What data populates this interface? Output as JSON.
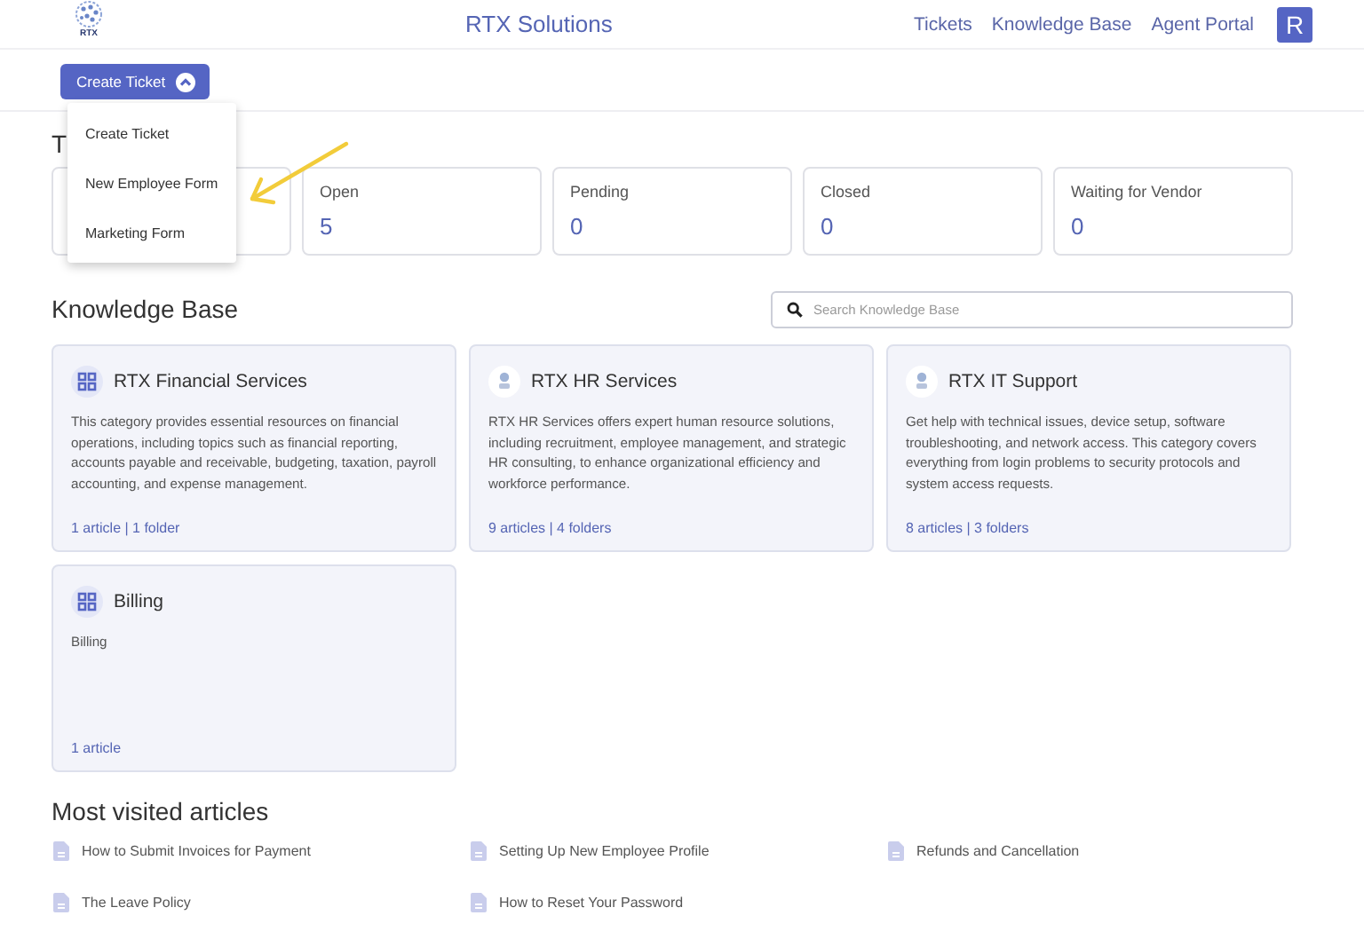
{
  "header": {
    "logo_text": "RTX",
    "title": "RTX Solutions",
    "nav": [
      "Tickets",
      "Knowledge Base",
      "Agent Portal"
    ],
    "avatar": "R"
  },
  "create_ticket": {
    "label": "Create Ticket",
    "expanded": true,
    "menu": [
      "Create Ticket",
      "New Employee Form",
      "Marketing Form"
    ]
  },
  "tickets": {
    "title": "T",
    "stats": [
      {
        "label": "Open",
        "value": "5"
      },
      {
        "label": "Pending",
        "value": "0"
      },
      {
        "label": "Closed",
        "value": "0"
      },
      {
        "label": "Waiting for Vendor",
        "value": "0"
      }
    ]
  },
  "knowledge_base": {
    "title": "Knowledge Base",
    "search": {
      "placeholder": "Search Knowledge Base"
    },
    "categories": [
      {
        "kind": "grid",
        "title": "RTX Financial Services",
        "description": "This category provides essential resources on financial operations, including topics such as financial reporting, accounts payable and receivable, budgeting, taxation, payroll accounting, and expense management.",
        "meta": "1 article | 1 folder"
      },
      {
        "kind": "logo",
        "title": "RTX HR Services",
        "description": "RTX HR Services offers expert human resource solutions, including recruitment, employee management, and strategic HR consulting, to enhance organizational efficiency and workforce performance.",
        "meta": "9 articles | 4 folders"
      },
      {
        "kind": "logo",
        "title": "RTX IT Support",
        "description": "Get help with technical issues, device setup, software troubleshooting, and network access. This category covers everything from login problems to security protocols and system access requests.",
        "meta": "8 articles | 3 folders"
      },
      {
        "kind": "grid",
        "title": "Billing",
        "description": "Billing",
        "meta": "1 article"
      }
    ]
  },
  "most_visited": {
    "title": "Most visited articles",
    "articles": [
      "How to Submit Invoices for Payment",
      "Setting Up New Employee Profile",
      "Refunds and Cancellation",
      "The Leave Policy",
      "How to Reset Your Password"
    ]
  }
}
